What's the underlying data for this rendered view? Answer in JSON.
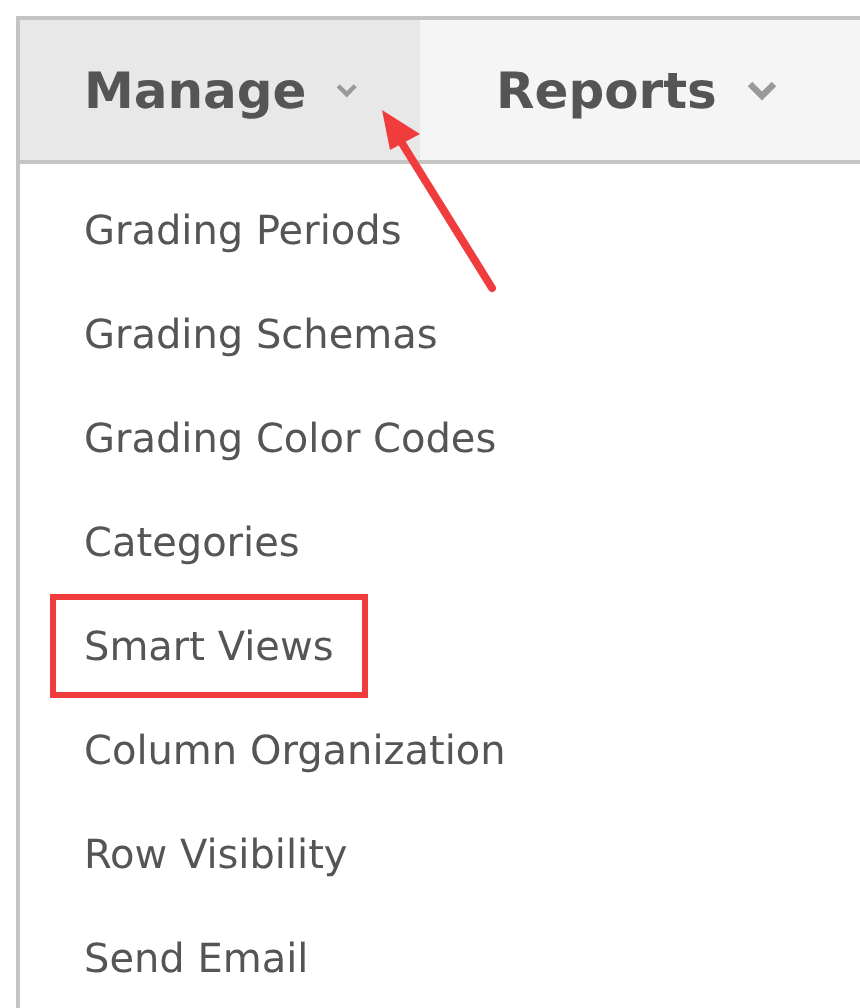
{
  "menu_bar": {
    "tabs": [
      {
        "label": "Manage",
        "selected": true,
        "has_dropdown": true
      },
      {
        "label": "Reports",
        "selected": false,
        "has_dropdown": true
      }
    ]
  },
  "dropdown": {
    "items": [
      {
        "label": "Grading Periods",
        "highlighted": false
      },
      {
        "label": "Grading Schemas",
        "highlighted": false
      },
      {
        "label": "Grading Color Codes",
        "highlighted": false
      },
      {
        "label": "Categories",
        "highlighted": false
      },
      {
        "label": "Smart Views",
        "highlighted": true
      },
      {
        "label": "Column Organization",
        "highlighted": false
      },
      {
        "label": "Row Visibility",
        "highlighted": false
      },
      {
        "label": "Send Email",
        "highlighted": false
      }
    ]
  }
}
